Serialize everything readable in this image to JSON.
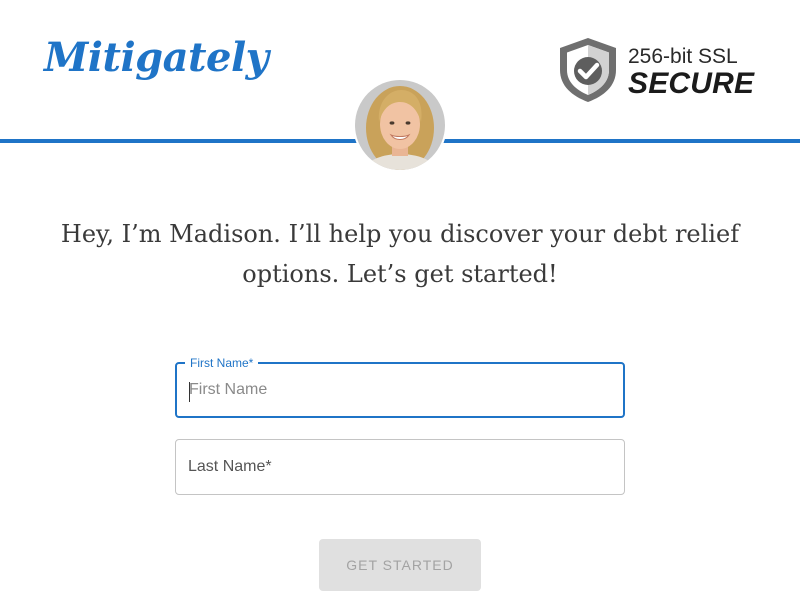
{
  "header": {
    "logo_text": "Mitigately",
    "brand_color": "#1f74c7",
    "ssl_badge": {
      "line1": "256-bit SSL",
      "line2": "SECURE",
      "icon": "shield-check-icon"
    },
    "avatar_icon": "advisor-photo"
  },
  "intro": {
    "line1": "Hey, I’m Madison. I’ll help you discover your debt relief",
    "line2": "options. Let’s get started!"
  },
  "form": {
    "first_name": {
      "label": "First Name*",
      "placeholder": "First Name",
      "value": ""
    },
    "last_name": {
      "placeholder": "Last Name*",
      "value": ""
    },
    "submit_label": "GET STARTED",
    "submit_disabled": true
  }
}
